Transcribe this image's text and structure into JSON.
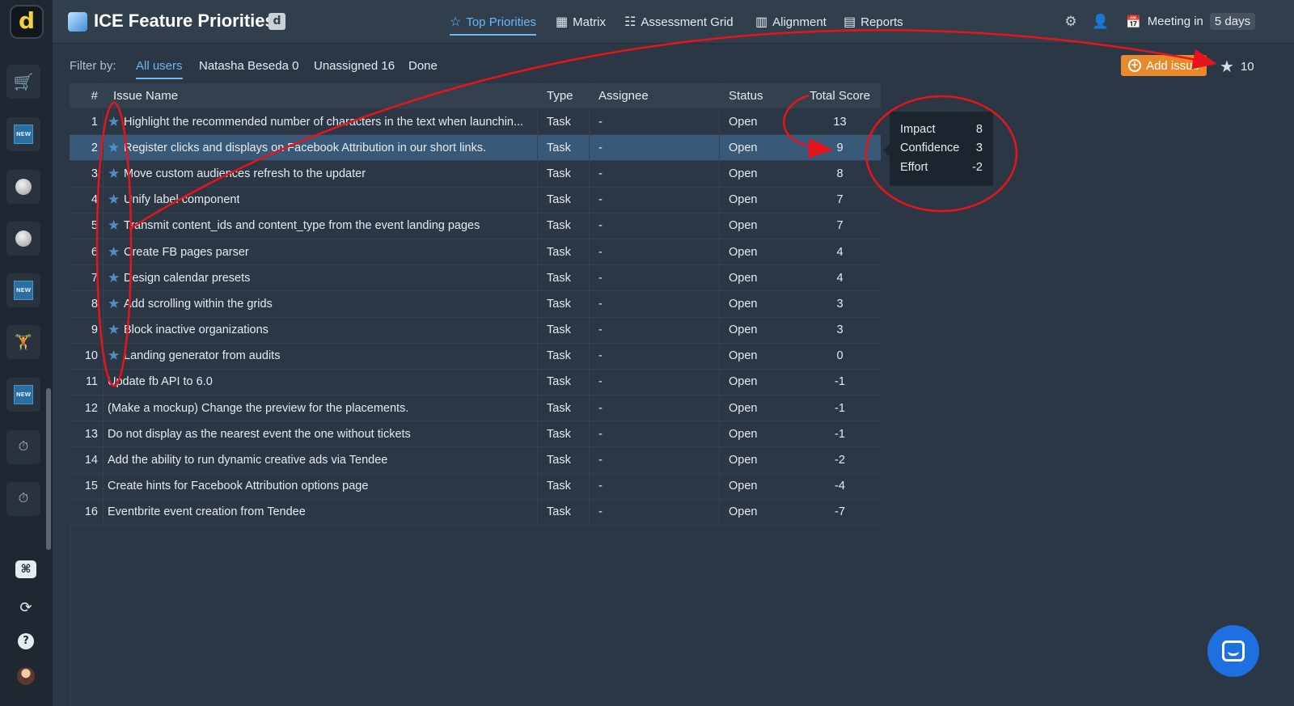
{
  "app": {
    "logo_letter": "d",
    "title": "ICE Feature Priorities",
    "title_badge": "d"
  },
  "nav": {
    "top_priorities": "Top Priorities",
    "matrix": "Matrix",
    "assessment_grid": "Assessment Grid",
    "alignment": "Alignment",
    "reports": "Reports"
  },
  "meeting": {
    "label": "Meeting in",
    "value": "5 days"
  },
  "filter": {
    "label": "Filter by:",
    "all_users": "All users",
    "natasha": "Natasha Beseda 0",
    "unassigned": "Unassigned 16",
    "done": "Done"
  },
  "actions": {
    "add_issue": "Add issue",
    "starred_count": "10"
  },
  "table": {
    "headers": {
      "num": "#",
      "name": "Issue Name",
      "type": "Type",
      "assignee": "Assignee",
      "status": "Status",
      "score": "Total Score"
    },
    "rows": [
      {
        "num": "1",
        "starred": true,
        "name": "Highlight the recommended number of characters in the text when launchin...",
        "type": "Task",
        "assignee": "-",
        "status": "Open",
        "score": "13"
      },
      {
        "num": "2",
        "starred": true,
        "name": "Register clicks and displays on Facebook Attribution in our short links.",
        "type": "Task",
        "assignee": "-",
        "status": "Open",
        "score": "9",
        "selected": true
      },
      {
        "num": "3",
        "starred": true,
        "name": "Move custom audiences refresh to the updater",
        "type": "Task",
        "assignee": "-",
        "status": "Open",
        "score": "8"
      },
      {
        "num": "4",
        "starred": true,
        "name": "Unify label component",
        "type": "Task",
        "assignee": "-",
        "status": "Open",
        "score": "7"
      },
      {
        "num": "5",
        "starred": true,
        "name": "Transmit content_ids and content_type from the event landing pages",
        "type": "Task",
        "assignee": "-",
        "status": "Open",
        "score": "7"
      },
      {
        "num": "6",
        "starred": true,
        "name": "Create FB pages parser",
        "type": "Task",
        "assignee": "-",
        "status": "Open",
        "score": "4"
      },
      {
        "num": "7",
        "starred": true,
        "name": "Design calendar presets",
        "type": "Task",
        "assignee": "-",
        "status": "Open",
        "score": "4"
      },
      {
        "num": "8",
        "starred": true,
        "name": "Add scrolling within the grids",
        "type": "Task",
        "assignee": "-",
        "status": "Open",
        "score": "3"
      },
      {
        "num": "9",
        "starred": true,
        "name": "Block inactive organizations",
        "type": "Task",
        "assignee": "-",
        "status": "Open",
        "score": "3"
      },
      {
        "num": "10",
        "starred": true,
        "name": "Landing generator from audits",
        "type": "Task",
        "assignee": "-",
        "status": "Open",
        "score": "0"
      },
      {
        "num": "11",
        "starred": false,
        "name": "Update fb API to 6.0",
        "type": "Task",
        "assignee": "-",
        "status": "Open",
        "score": "-1"
      },
      {
        "num": "12",
        "starred": false,
        "name": "(Make a mockup) Change the preview for the placements.",
        "type": "Task",
        "assignee": "-",
        "status": "Open",
        "score": "-1"
      },
      {
        "num": "13",
        "starred": false,
        "name": "Do not display as the nearest event the one without tickets",
        "type": "Task",
        "assignee": "-",
        "status": "Open",
        "score": "-1"
      },
      {
        "num": "14",
        "starred": false,
        "name": "Add the ability to run dynamic creative ads via Tendee",
        "type": "Task",
        "assignee": "-",
        "status": "Open",
        "score": "-2"
      },
      {
        "num": "15",
        "starred": false,
        "name": "Create hints for Facebook Attribution options page",
        "type": "Task",
        "assignee": "-",
        "status": "Open",
        "score": "-4"
      },
      {
        "num": "16",
        "starred": false,
        "name": "Eventbrite event creation from Tendee",
        "type": "Task",
        "assignee": "-",
        "status": "Open",
        "score": "-7"
      }
    ]
  },
  "tooltip": {
    "impact_label": "Impact",
    "impact_value": "8",
    "confidence_label": "Confidence",
    "confidence_value": "3",
    "effort_label": "Effort",
    "effort_value": "-2"
  },
  "sidebar": {
    "new_badge": "NEW",
    "icons": [
      "cart-icon",
      "new-badge-icon",
      "ball-icon",
      "ball-icon",
      "new-badge-icon",
      "weightlifter-icon",
      "new-badge-icon",
      "stopwatch-icon",
      "stopwatch-icon"
    ],
    "bottom_icons": [
      "command-key-icon",
      "refresh-icon",
      "help-icon",
      "avatar"
    ]
  },
  "colors": {
    "accent": "#6ab7f5",
    "add_issue": "#e8892b",
    "annotation": "#e8141c",
    "chat": "#1e6fe0",
    "selected_row": "#385a78"
  }
}
